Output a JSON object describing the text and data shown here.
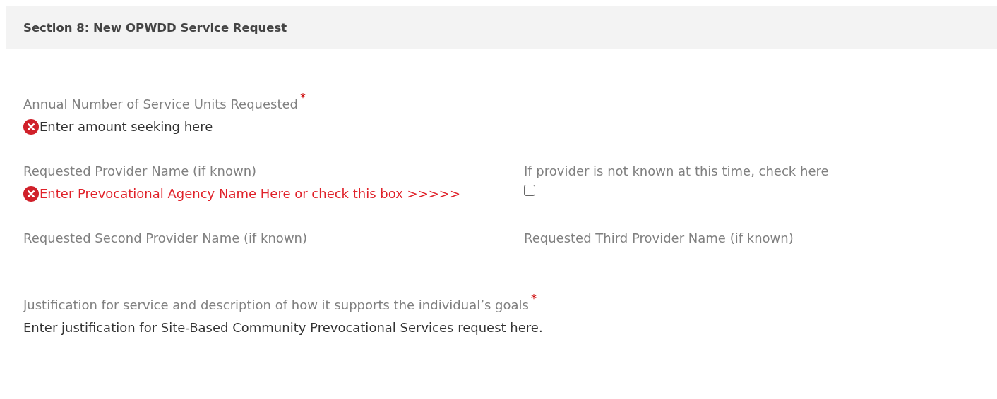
{
  "section": {
    "title": "Section 8: New OPWDD Service Request"
  },
  "rows": [
    [
      {
        "kind": "text",
        "label": "Annual Number of Service Units Requested",
        "required_mark": "*",
        "error": true,
        "alert_text": false,
        "value": "Enter amount seeking here"
      }
    ],
    [
      {
        "kind": "text",
        "label": "Requested Provider Name (if known)",
        "error": true,
        "alert_text": true,
        "value": "Enter Prevocational Agency Name Here or check this box >>>>>"
      },
      {
        "kind": "checkbox",
        "label": "If provider is not known at this time, check here",
        "checked": false
      }
    ],
    [
      {
        "kind": "line",
        "label": "Requested Second Provider Name (if known)"
      },
      {
        "kind": "line",
        "label": "Requested Third Provider Name (if known)"
      }
    ],
    [
      {
        "kind": "text",
        "label": "Justification for service and description of how it supports the individual’s goals",
        "required_mark": "*",
        "error": false,
        "alert_text": false,
        "value": "Enter justification for Site-Based Community Prevocational Services request here."
      }
    ]
  ]
}
